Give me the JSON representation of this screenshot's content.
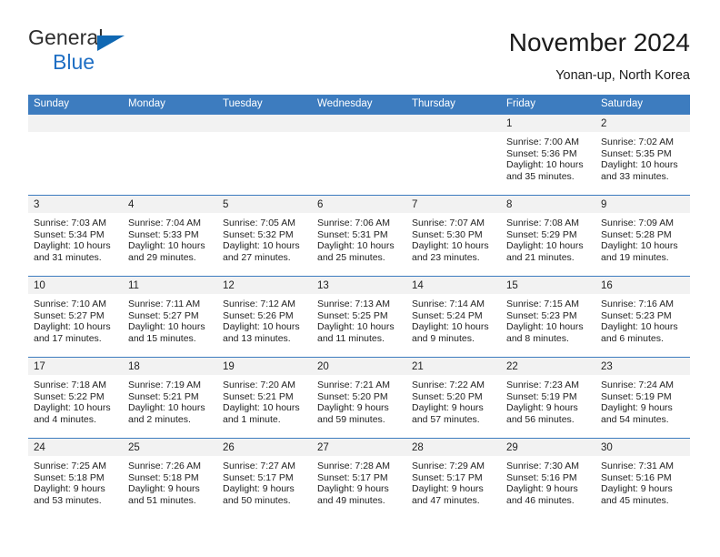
{
  "brand": {
    "name_top": "General",
    "name_bottom": "Blue",
    "triangle_color": "#1068b3",
    "text_color": "#2d2d2d",
    "blue_color": "#1f6fc4"
  },
  "header": {
    "title": "November 2024",
    "subtitle": "Yonan-up, North Korea"
  },
  "theme": {
    "header_bg": "#3d7cbf",
    "header_text": "#ffffff",
    "day_band_bg": "#f2f2f2",
    "row_border": "#3d7cbf",
    "body_text": "#222222"
  },
  "weekdays": [
    "Sunday",
    "Monday",
    "Tuesday",
    "Wednesday",
    "Thursday",
    "Friday",
    "Saturday"
  ],
  "weeks": [
    [
      {
        "day": "",
        "empty": true,
        "sunrise": "",
        "sunset": "",
        "daylight1": "",
        "daylight2": ""
      },
      {
        "day": "",
        "empty": true,
        "sunrise": "",
        "sunset": "",
        "daylight1": "",
        "daylight2": ""
      },
      {
        "day": "",
        "empty": true,
        "sunrise": "",
        "sunset": "",
        "daylight1": "",
        "daylight2": ""
      },
      {
        "day": "",
        "empty": true,
        "sunrise": "",
        "sunset": "",
        "daylight1": "",
        "daylight2": ""
      },
      {
        "day": "",
        "empty": true,
        "sunrise": "",
        "sunset": "",
        "daylight1": "",
        "daylight2": ""
      },
      {
        "day": "1",
        "empty": false,
        "sunrise": "Sunrise: 7:00 AM",
        "sunset": "Sunset: 5:36 PM",
        "daylight1": "Daylight: 10 hours",
        "daylight2": "and 35 minutes."
      },
      {
        "day": "2",
        "empty": false,
        "sunrise": "Sunrise: 7:02 AM",
        "sunset": "Sunset: 5:35 PM",
        "daylight1": "Daylight: 10 hours",
        "daylight2": "and 33 minutes."
      }
    ],
    [
      {
        "day": "3",
        "empty": false,
        "sunrise": "Sunrise: 7:03 AM",
        "sunset": "Sunset: 5:34 PM",
        "daylight1": "Daylight: 10 hours",
        "daylight2": "and 31 minutes."
      },
      {
        "day": "4",
        "empty": false,
        "sunrise": "Sunrise: 7:04 AM",
        "sunset": "Sunset: 5:33 PM",
        "daylight1": "Daylight: 10 hours",
        "daylight2": "and 29 minutes."
      },
      {
        "day": "5",
        "empty": false,
        "sunrise": "Sunrise: 7:05 AM",
        "sunset": "Sunset: 5:32 PM",
        "daylight1": "Daylight: 10 hours",
        "daylight2": "and 27 minutes."
      },
      {
        "day": "6",
        "empty": false,
        "sunrise": "Sunrise: 7:06 AM",
        "sunset": "Sunset: 5:31 PM",
        "daylight1": "Daylight: 10 hours",
        "daylight2": "and 25 minutes."
      },
      {
        "day": "7",
        "empty": false,
        "sunrise": "Sunrise: 7:07 AM",
        "sunset": "Sunset: 5:30 PM",
        "daylight1": "Daylight: 10 hours",
        "daylight2": "and 23 minutes."
      },
      {
        "day": "8",
        "empty": false,
        "sunrise": "Sunrise: 7:08 AM",
        "sunset": "Sunset: 5:29 PM",
        "daylight1": "Daylight: 10 hours",
        "daylight2": "and 21 minutes."
      },
      {
        "day": "9",
        "empty": false,
        "sunrise": "Sunrise: 7:09 AM",
        "sunset": "Sunset: 5:28 PM",
        "daylight1": "Daylight: 10 hours",
        "daylight2": "and 19 minutes."
      }
    ],
    [
      {
        "day": "10",
        "empty": false,
        "sunrise": "Sunrise: 7:10 AM",
        "sunset": "Sunset: 5:27 PM",
        "daylight1": "Daylight: 10 hours",
        "daylight2": "and 17 minutes."
      },
      {
        "day": "11",
        "empty": false,
        "sunrise": "Sunrise: 7:11 AM",
        "sunset": "Sunset: 5:27 PM",
        "daylight1": "Daylight: 10 hours",
        "daylight2": "and 15 minutes."
      },
      {
        "day": "12",
        "empty": false,
        "sunrise": "Sunrise: 7:12 AM",
        "sunset": "Sunset: 5:26 PM",
        "daylight1": "Daylight: 10 hours",
        "daylight2": "and 13 minutes."
      },
      {
        "day": "13",
        "empty": false,
        "sunrise": "Sunrise: 7:13 AM",
        "sunset": "Sunset: 5:25 PM",
        "daylight1": "Daylight: 10 hours",
        "daylight2": "and 11 minutes."
      },
      {
        "day": "14",
        "empty": false,
        "sunrise": "Sunrise: 7:14 AM",
        "sunset": "Sunset: 5:24 PM",
        "daylight1": "Daylight: 10 hours",
        "daylight2": "and 9 minutes."
      },
      {
        "day": "15",
        "empty": false,
        "sunrise": "Sunrise: 7:15 AM",
        "sunset": "Sunset: 5:23 PM",
        "daylight1": "Daylight: 10 hours",
        "daylight2": "and 8 minutes."
      },
      {
        "day": "16",
        "empty": false,
        "sunrise": "Sunrise: 7:16 AM",
        "sunset": "Sunset: 5:23 PM",
        "daylight1": "Daylight: 10 hours",
        "daylight2": "and 6 minutes."
      }
    ],
    [
      {
        "day": "17",
        "empty": false,
        "sunrise": "Sunrise: 7:18 AM",
        "sunset": "Sunset: 5:22 PM",
        "daylight1": "Daylight: 10 hours",
        "daylight2": "and 4 minutes."
      },
      {
        "day": "18",
        "empty": false,
        "sunrise": "Sunrise: 7:19 AM",
        "sunset": "Sunset: 5:21 PM",
        "daylight1": "Daylight: 10 hours",
        "daylight2": "and 2 minutes."
      },
      {
        "day": "19",
        "empty": false,
        "sunrise": "Sunrise: 7:20 AM",
        "sunset": "Sunset: 5:21 PM",
        "daylight1": "Daylight: 10 hours",
        "daylight2": "and 1 minute."
      },
      {
        "day": "20",
        "empty": false,
        "sunrise": "Sunrise: 7:21 AM",
        "sunset": "Sunset: 5:20 PM",
        "daylight1": "Daylight: 9 hours",
        "daylight2": "and 59 minutes."
      },
      {
        "day": "21",
        "empty": false,
        "sunrise": "Sunrise: 7:22 AM",
        "sunset": "Sunset: 5:20 PM",
        "daylight1": "Daylight: 9 hours",
        "daylight2": "and 57 minutes."
      },
      {
        "day": "22",
        "empty": false,
        "sunrise": "Sunrise: 7:23 AM",
        "sunset": "Sunset: 5:19 PM",
        "daylight1": "Daylight: 9 hours",
        "daylight2": "and 56 minutes."
      },
      {
        "day": "23",
        "empty": false,
        "sunrise": "Sunrise: 7:24 AM",
        "sunset": "Sunset: 5:19 PM",
        "daylight1": "Daylight: 9 hours",
        "daylight2": "and 54 minutes."
      }
    ],
    [
      {
        "day": "24",
        "empty": false,
        "sunrise": "Sunrise: 7:25 AM",
        "sunset": "Sunset: 5:18 PM",
        "daylight1": "Daylight: 9 hours",
        "daylight2": "and 53 minutes."
      },
      {
        "day": "25",
        "empty": false,
        "sunrise": "Sunrise: 7:26 AM",
        "sunset": "Sunset: 5:18 PM",
        "daylight1": "Daylight: 9 hours",
        "daylight2": "and 51 minutes."
      },
      {
        "day": "26",
        "empty": false,
        "sunrise": "Sunrise: 7:27 AM",
        "sunset": "Sunset: 5:17 PM",
        "daylight1": "Daylight: 9 hours",
        "daylight2": "and 50 minutes."
      },
      {
        "day": "27",
        "empty": false,
        "sunrise": "Sunrise: 7:28 AM",
        "sunset": "Sunset: 5:17 PM",
        "daylight1": "Daylight: 9 hours",
        "daylight2": "and 49 minutes."
      },
      {
        "day": "28",
        "empty": false,
        "sunrise": "Sunrise: 7:29 AM",
        "sunset": "Sunset: 5:17 PM",
        "daylight1": "Daylight: 9 hours",
        "daylight2": "and 47 minutes."
      },
      {
        "day": "29",
        "empty": false,
        "sunrise": "Sunrise: 7:30 AM",
        "sunset": "Sunset: 5:16 PM",
        "daylight1": "Daylight: 9 hours",
        "daylight2": "and 46 minutes."
      },
      {
        "day": "30",
        "empty": false,
        "sunrise": "Sunrise: 7:31 AM",
        "sunset": "Sunset: 5:16 PM",
        "daylight1": "Daylight: 9 hours",
        "daylight2": "and 45 minutes."
      }
    ]
  ]
}
